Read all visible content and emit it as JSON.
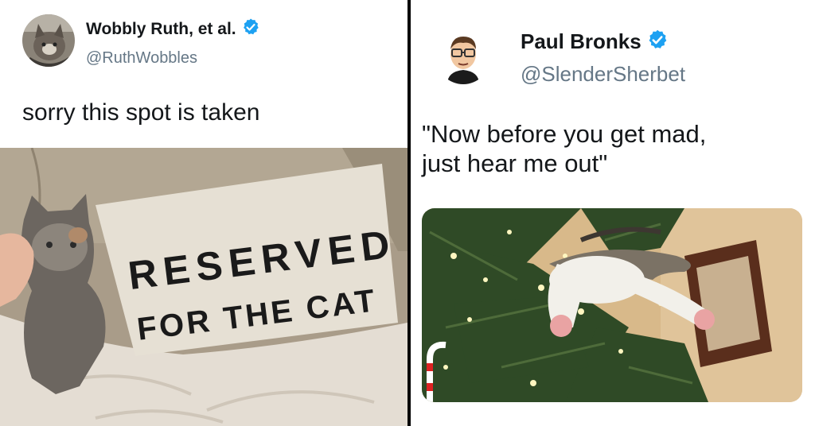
{
  "left_tweet": {
    "display_name": "Wobbly Ruth, et al.",
    "handle": "@RuthWobbles",
    "text": "sorry this spot is taken",
    "pillow_line1": "RESERVED",
    "pillow_line2": "FOR THE CAT"
  },
  "right_tweet": {
    "display_name": "Paul Bronks",
    "handle": "@SlenderSherbet",
    "text_line1": "\"Now before you get mad,",
    "text_line2": "just hear me out\""
  },
  "colors": {
    "verified_badge": "#1da1f2",
    "name_text": "#14171a",
    "handle_text": "#657786"
  },
  "icons": {
    "verified": "verified-badge-icon"
  }
}
